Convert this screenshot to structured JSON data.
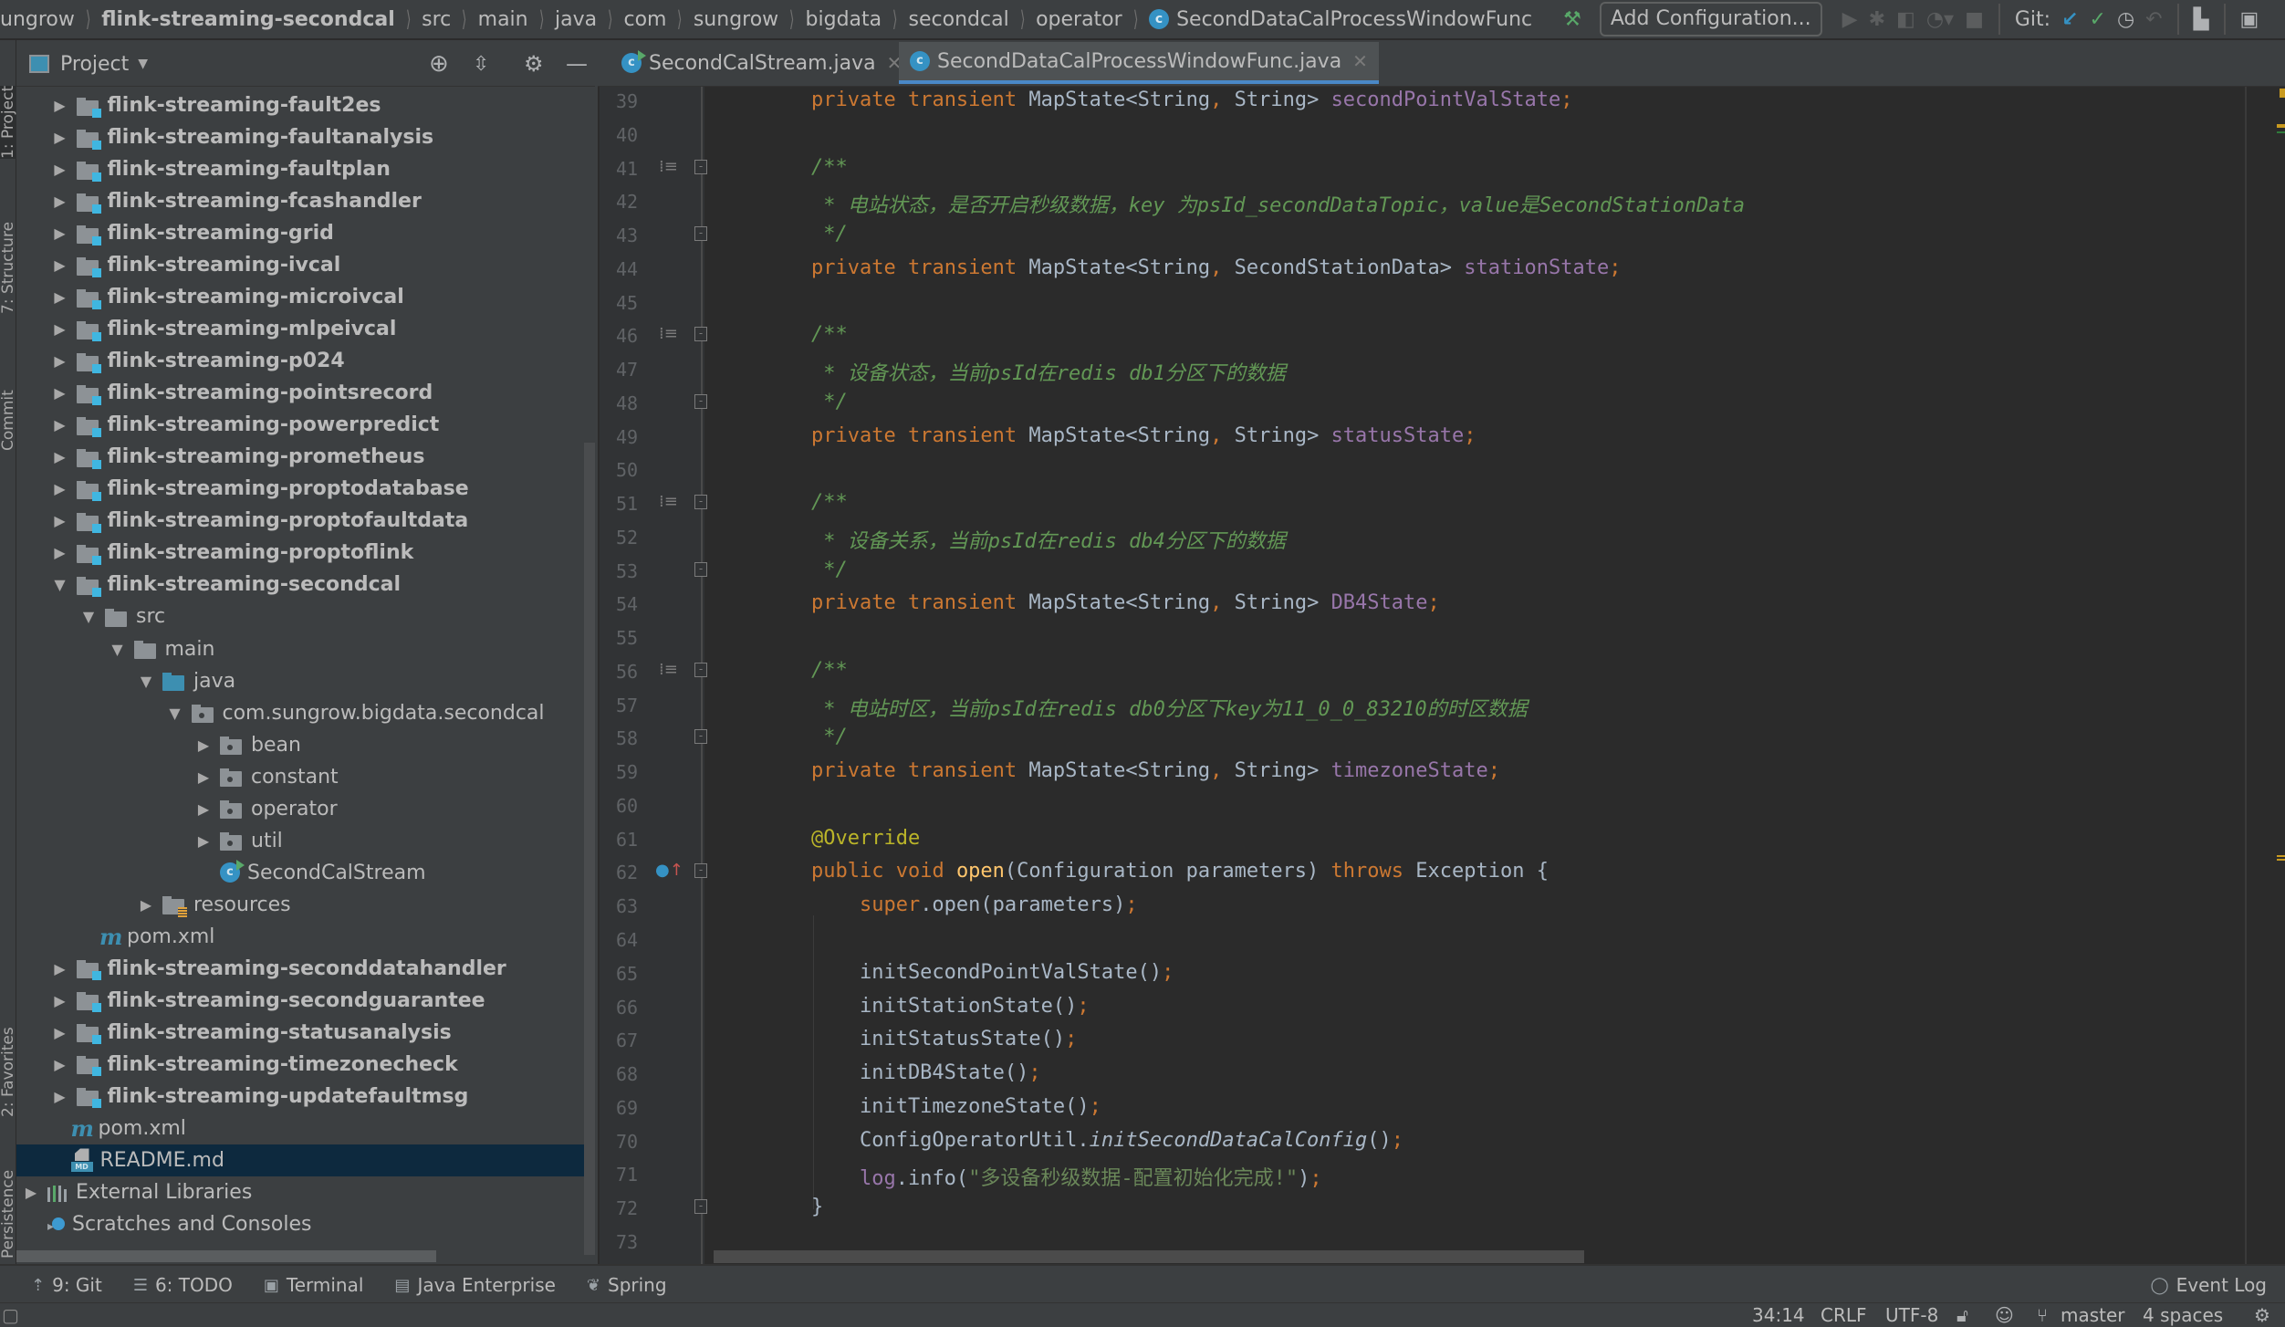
{
  "navbar": {
    "breadcrumbs": [
      "ungrow",
      "flink-streaming-secondcal",
      "src",
      "main",
      "java",
      "com",
      "sungrow",
      "bigdata",
      "secondcal",
      "operator",
      "SecondDataCalProcessWindowFunc"
    ],
    "add_configuration": "Add Configuration...",
    "git_label": "Git:"
  },
  "left_strip": {
    "tabs": [
      "1: Project",
      "7: Structure",
      "Commit",
      "2: Favorites",
      "Persistence"
    ]
  },
  "project_panel": {
    "title": "Project",
    "tree": [
      {
        "label": "flink-streaming-fault2es",
        "type": "module",
        "depth": 1,
        "expanded": false
      },
      {
        "label": "flink-streaming-faultanalysis",
        "type": "module",
        "depth": 1,
        "expanded": false
      },
      {
        "label": "flink-streaming-faultplan",
        "type": "module",
        "depth": 1,
        "expanded": false
      },
      {
        "label": "flink-streaming-fcashandler",
        "type": "module",
        "depth": 1,
        "expanded": false
      },
      {
        "label": "flink-streaming-grid",
        "type": "module",
        "depth": 1,
        "expanded": false
      },
      {
        "label": "flink-streaming-ivcal",
        "type": "module",
        "depth": 1,
        "expanded": false
      },
      {
        "label": "flink-streaming-microivcal",
        "type": "module",
        "depth": 1,
        "expanded": false
      },
      {
        "label": "flink-streaming-mlpeivcal",
        "type": "module",
        "depth": 1,
        "expanded": false
      },
      {
        "label": "flink-streaming-p024",
        "type": "module",
        "depth": 1,
        "expanded": false
      },
      {
        "label": "flink-streaming-pointsrecord",
        "type": "module",
        "depth": 1,
        "expanded": false
      },
      {
        "label": "flink-streaming-powerpredict",
        "type": "module",
        "depth": 1,
        "expanded": false
      },
      {
        "label": "flink-streaming-prometheus",
        "type": "module",
        "depth": 1,
        "expanded": false
      },
      {
        "label": "flink-streaming-proptodatabase",
        "type": "module",
        "depth": 1,
        "expanded": false
      },
      {
        "label": "flink-streaming-proptofaultdata",
        "type": "module",
        "depth": 1,
        "expanded": false
      },
      {
        "label": "flink-streaming-proptoflink",
        "type": "module",
        "depth": 1,
        "expanded": false
      },
      {
        "label": "flink-streaming-secondcal",
        "type": "module",
        "depth": 1,
        "expanded": true
      },
      {
        "label": "src",
        "type": "folder",
        "depth": 2,
        "expanded": true
      },
      {
        "label": "main",
        "type": "folder",
        "depth": 3,
        "expanded": true
      },
      {
        "label": "java",
        "type": "src",
        "depth": 4,
        "expanded": true
      },
      {
        "label": "com.sungrow.bigdata.secondcal",
        "type": "pkg",
        "depth": 5,
        "expanded": true
      },
      {
        "label": "bean",
        "type": "pkg",
        "depth": 6,
        "expanded": false
      },
      {
        "label": "constant",
        "type": "pkg",
        "depth": 6,
        "expanded": false
      },
      {
        "label": "operator",
        "type": "pkg",
        "depth": 6,
        "expanded": false
      },
      {
        "label": "util",
        "type": "pkg",
        "depth": 6,
        "expanded": false
      },
      {
        "label": "SecondCalStream",
        "type": "class",
        "depth": 6,
        "expanded": null
      },
      {
        "label": "resources",
        "type": "res",
        "depth": 4,
        "expanded": false
      },
      {
        "label": "pom.xml",
        "type": "maven",
        "depth": 2,
        "expanded": null
      },
      {
        "label": "flink-streaming-seconddatahandler",
        "type": "module",
        "depth": 1,
        "expanded": false
      },
      {
        "label": "flink-streaming-secondguarantee",
        "type": "module",
        "depth": 1,
        "expanded": false
      },
      {
        "label": "flink-streaming-statusanalysis",
        "type": "module",
        "depth": 1,
        "expanded": false
      },
      {
        "label": "flink-streaming-timezonecheck",
        "type": "module",
        "depth": 1,
        "expanded": false
      },
      {
        "label": "flink-streaming-updatefaultmsg",
        "type": "module",
        "depth": 1,
        "expanded": false
      },
      {
        "label": "pom.xml",
        "type": "maven",
        "depth": 1,
        "expanded": null
      },
      {
        "label": "README.md",
        "type": "md",
        "depth": 1,
        "expanded": null,
        "selected": true
      },
      {
        "label": "External Libraries",
        "type": "lib",
        "depth": 0,
        "expanded": false
      },
      {
        "label": "Scratches and Consoles",
        "type": "scratch",
        "depth": 0,
        "expanded": null
      }
    ]
  },
  "editor": {
    "tabs": [
      {
        "label": "SecondCalStream.java",
        "active": false
      },
      {
        "label": "SecondDataCalProcessWindowFunc.java",
        "active": true
      }
    ],
    "lines": [
      {
        "n": 39,
        "tokens": [
          [
            "kw",
            "    private "
          ],
          [
            "kw",
            "transient "
          ],
          [
            "type",
            "MapState<String"
          ],
          [
            "semi",
            ", "
          ],
          [
            "type",
            "String> "
          ],
          [
            "fld",
            "secondPointValState"
          ],
          [
            "semi",
            ";"
          ]
        ]
      },
      {
        "n": 40,
        "tokens": []
      },
      {
        "n": 41,
        "tokens": [
          [
            "cmt",
            "    /**"
          ]
        ],
        "doc": true,
        "fold": "start"
      },
      {
        "n": 42,
        "tokens": [
          [
            "cmt",
            "     * 电站状态，是否开启秒级数据，key 为psId_secondDataTopic，value是SecondStationData"
          ]
        ]
      },
      {
        "n": 43,
        "tokens": [
          [
            "cmt",
            "     */"
          ]
        ],
        "fold": "end"
      },
      {
        "n": 44,
        "tokens": [
          [
            "kw",
            "    private "
          ],
          [
            "kw",
            "transient "
          ],
          [
            "type",
            "MapState<String"
          ],
          [
            "semi",
            ", "
          ],
          [
            "type",
            "SecondStationData> "
          ],
          [
            "fld",
            "stationState"
          ],
          [
            "semi",
            ";"
          ]
        ]
      },
      {
        "n": 45,
        "tokens": []
      },
      {
        "n": 46,
        "tokens": [
          [
            "cmt",
            "    /**"
          ]
        ],
        "doc": true,
        "fold": "start"
      },
      {
        "n": 47,
        "tokens": [
          [
            "cmt",
            "     * 设备状态，当前psId在redis db1分区下的数据"
          ]
        ]
      },
      {
        "n": 48,
        "tokens": [
          [
            "cmt",
            "     */"
          ]
        ],
        "fold": "end"
      },
      {
        "n": 49,
        "tokens": [
          [
            "kw",
            "    private "
          ],
          [
            "kw",
            "transient "
          ],
          [
            "type",
            "MapState<String"
          ],
          [
            "semi",
            ", "
          ],
          [
            "type",
            "String> "
          ],
          [
            "fld",
            "statusState"
          ],
          [
            "semi",
            ";"
          ]
        ]
      },
      {
        "n": 50,
        "tokens": []
      },
      {
        "n": 51,
        "tokens": [
          [
            "cmt",
            "    /**"
          ]
        ],
        "doc": true,
        "fold": "start"
      },
      {
        "n": 52,
        "tokens": [
          [
            "cmt",
            "     * 设备关系，当前psId在redis db4分区下的数据"
          ]
        ]
      },
      {
        "n": 53,
        "tokens": [
          [
            "cmt",
            "     */"
          ]
        ],
        "fold": "end"
      },
      {
        "n": 54,
        "tokens": [
          [
            "kw",
            "    private "
          ],
          [
            "kw",
            "transient "
          ],
          [
            "type",
            "MapState<String"
          ],
          [
            "semi",
            ", "
          ],
          [
            "type",
            "String> "
          ],
          [
            "fld",
            "DB4State"
          ],
          [
            "semi",
            ";"
          ]
        ]
      },
      {
        "n": 55,
        "tokens": []
      },
      {
        "n": 56,
        "tokens": [
          [
            "cmt",
            "    /**"
          ]
        ],
        "doc": true,
        "fold": "start"
      },
      {
        "n": 57,
        "tokens": [
          [
            "cmt",
            "     * 电站时区，当前psId在redis db0分区下key为11_0_0_83210的时区数据"
          ]
        ]
      },
      {
        "n": 58,
        "tokens": [
          [
            "cmt",
            "     */"
          ]
        ],
        "fold": "end"
      },
      {
        "n": 59,
        "tokens": [
          [
            "kw",
            "    private "
          ],
          [
            "kw",
            "transient "
          ],
          [
            "type",
            "MapState<String"
          ],
          [
            "semi",
            ", "
          ],
          [
            "type",
            "String> "
          ],
          [
            "fld",
            "timezoneState"
          ],
          [
            "semi",
            ";"
          ]
        ]
      },
      {
        "n": 60,
        "tokens": []
      },
      {
        "n": 61,
        "tokens": [
          [
            "ann",
            "    @Override"
          ]
        ]
      },
      {
        "n": 62,
        "tokens": [
          [
            "kw",
            "    public "
          ],
          [
            "kw",
            "void "
          ],
          [
            "fn",
            "open"
          ],
          [
            "type",
            "(Configuration parameters) "
          ],
          [
            "kw",
            "throws "
          ],
          [
            "type",
            "Exception {"
          ]
        ],
        "override": true,
        "fold": "start"
      },
      {
        "n": 63,
        "tokens": [
          [
            "kw",
            "        super"
          ],
          [
            "type",
            ".open(parameters)"
          ],
          [
            "semi",
            ";"
          ]
        ]
      },
      {
        "n": 64,
        "tokens": []
      },
      {
        "n": 65,
        "tokens": [
          [
            "type",
            "        initSecondPointValState()"
          ],
          [
            "semi",
            ";"
          ]
        ]
      },
      {
        "n": 66,
        "tokens": [
          [
            "type",
            "        initStationState()"
          ],
          [
            "semi",
            ";"
          ]
        ]
      },
      {
        "n": 67,
        "tokens": [
          [
            "type",
            "        initStatusState()"
          ],
          [
            "semi",
            ";"
          ]
        ]
      },
      {
        "n": 68,
        "tokens": [
          [
            "type",
            "        initDB4State()"
          ],
          [
            "semi",
            ";"
          ]
        ]
      },
      {
        "n": 69,
        "tokens": [
          [
            "type",
            "        initTimezoneState()"
          ],
          [
            "semi",
            ";"
          ]
        ]
      },
      {
        "n": 70,
        "tokens": [
          [
            "type",
            "        ConfigOperatorUtil."
          ],
          [
            "ital",
            "initSecondDataCalConfig"
          ],
          [
            "type",
            "()"
          ],
          [
            "semi",
            ";"
          ]
        ]
      },
      {
        "n": 71,
        "tokens": [
          [
            "fld",
            "        log"
          ],
          [
            "type",
            ".info("
          ],
          [
            "str",
            "\"多设备秒级数据-配置初始化完成!\""
          ],
          [
            "type",
            ")"
          ],
          [
            "semi",
            ";"
          ]
        ]
      },
      {
        "n": 72,
        "tokens": [
          [
            "type",
            "    }"
          ]
        ],
        "fold": "end"
      },
      {
        "n": 73,
        "tokens": []
      }
    ]
  },
  "bottom_tools": [
    {
      "icon": "git-icon",
      "label": "9: Git"
    },
    {
      "icon": "todo-icon",
      "label": "6: TODO"
    },
    {
      "icon": "terminal-icon",
      "label": "Terminal"
    },
    {
      "icon": "java-enterprise-icon",
      "label": "Java Enterprise"
    },
    {
      "icon": "spring-icon",
      "label": "Spring"
    }
  ],
  "event_log": "Event Log",
  "status": {
    "position": "34:14",
    "line_sep": "CRLF",
    "encoding": "UTF-8",
    "branch": "master",
    "indent": "4 spaces"
  },
  "colors": {
    "accent": "#4a88c7",
    "selection": "#0d293e",
    "editor_bg": "#2b2b2b",
    "panel_bg": "#3c3f41"
  }
}
